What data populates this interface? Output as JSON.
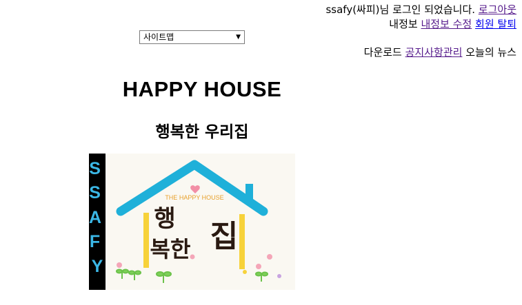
{
  "header": {
    "greeting_user": "ssafy(싸피)님 로그인 되었습니다.",
    "logout_link": "로그아웃",
    "my_info": "내정보",
    "edit_info_link": "내정보 수정",
    "withdraw_link": "회원 탈퇴",
    "download": "다운로드",
    "notice_admin_link": "공지사항관리",
    "today_news": "오늘의 뉴스"
  },
  "sitemap": {
    "selected": "사이트맵"
  },
  "main": {
    "title": "HAPPY HOUSE",
    "subtitle": "행복한 우리집"
  },
  "banner": {
    "side_text": "SSAFY",
    "roof_text": "THE HAPPY HOUSE",
    "calligraphy_line1": "행",
    "calligraphy_line2": "복한",
    "calligraphy_line3": "집",
    "colors": {
      "roof": "#1fb0d9",
      "pillar": "#f7d23a",
      "ink": "#2a1a12",
      "side_bar": "#000000",
      "side_letters": "#3bb7e6"
    }
  }
}
